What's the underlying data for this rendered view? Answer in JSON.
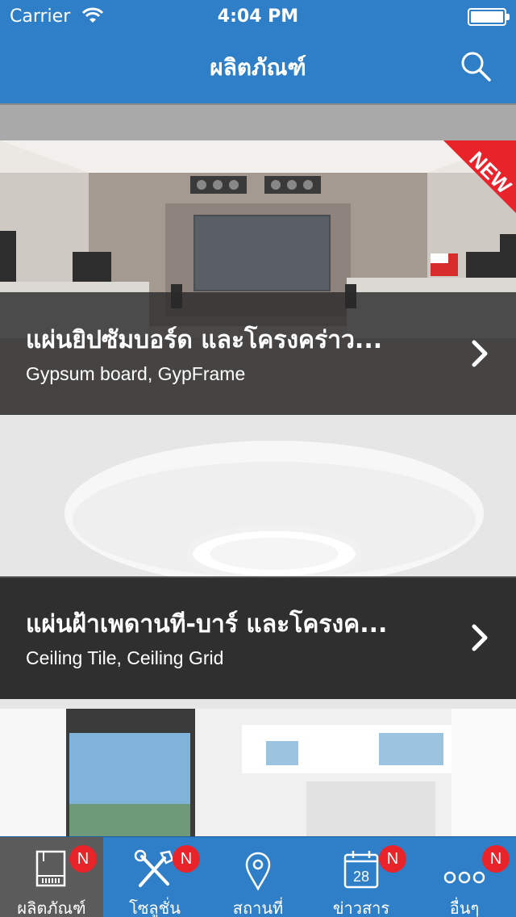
{
  "status_bar": {
    "carrier": "Carrier",
    "time": "4:04 PM"
  },
  "nav": {
    "title": "ผลิตภัณฑ์",
    "search_icon": "search-icon"
  },
  "cards": [
    {
      "title": "แผ่นยิปซัมบอร์ด และโครงคร่าว...",
      "subtitle": "Gypsum board, GypFrame",
      "badge": "NEW"
    },
    {
      "title": "แผ่นฝ้าเพดานที-บาร์ และโครงค...",
      "subtitle": "Ceiling Tile, Ceiling Grid"
    },
    {
      "title": "",
      "subtitle": ""
    }
  ],
  "tabs": [
    {
      "label": "ผลิตภัณฑ์",
      "badge": "N",
      "icon": "product-catalog-icon",
      "active": true
    },
    {
      "label": "โซลูชั่น",
      "badge": "N",
      "icon": "tools-icon"
    },
    {
      "label": "สถานที่",
      "badge": "N",
      "icon": "location-pin-icon"
    },
    {
      "label": "ข่าวสาร",
      "badge": "N",
      "icon": "calendar-icon",
      "calendar_day": "28"
    },
    {
      "label": "อื่นๆ",
      "badge": "N",
      "icon": "more-icon"
    }
  ],
  "colors": {
    "primary": "#2f7fc8",
    "badge": "#e8232a",
    "active_tab": "#5b5b5b"
  }
}
